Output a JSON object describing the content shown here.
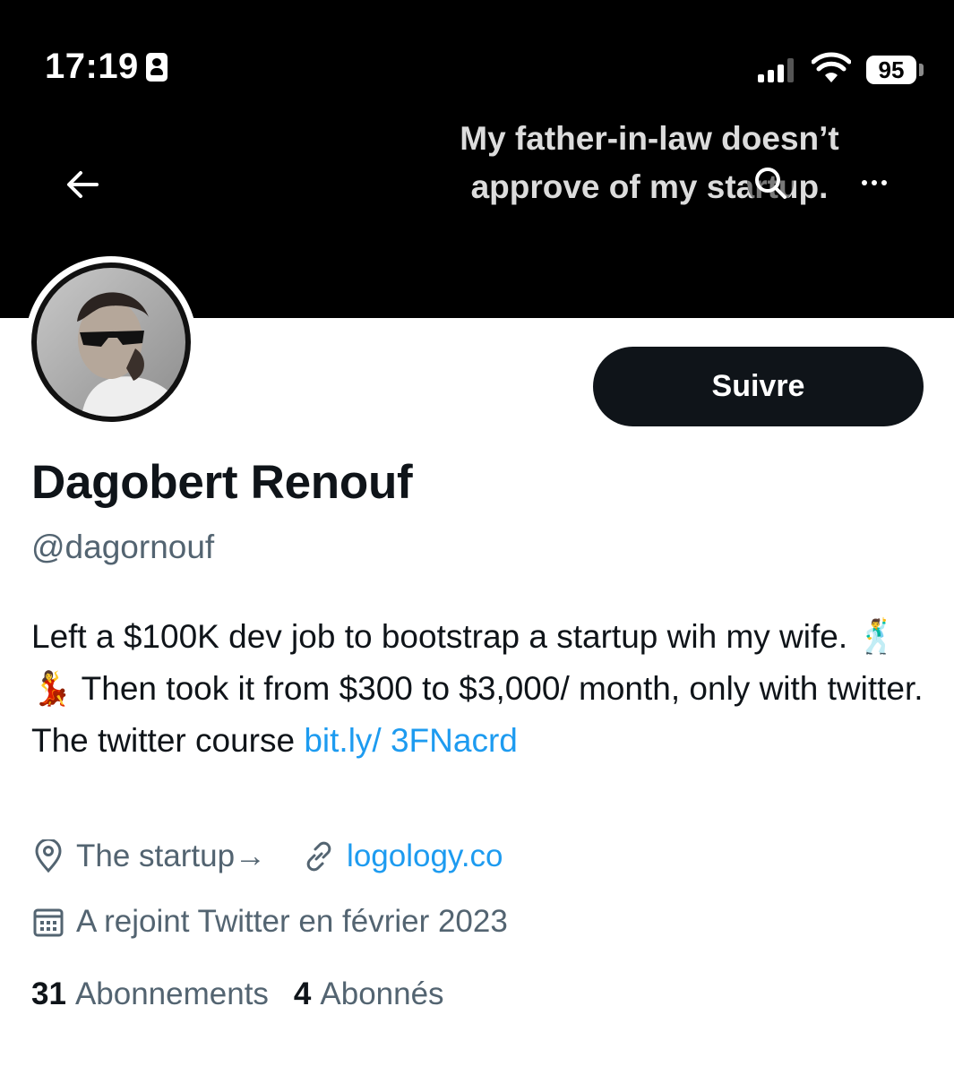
{
  "status_bar": {
    "time": "17:19",
    "battery": "95"
  },
  "banner": {
    "caption_line1": "My father-in-law doesn’t",
    "caption_line2": "approve of my startup."
  },
  "profile": {
    "follow_label": "Suivre",
    "name": "Dagobert Renouf",
    "handle": "@dagornouf",
    "bio": {
      "part1": "Left a $100K dev job to bootstrap a startup wih my wife. 🕺💃 Then took it from $300 to $3,000/ month, only with twitter. The twitter course ",
      "link": "bit.ly/ 3FNacrd"
    },
    "location": "The startup→",
    "website": "logology.co",
    "joined": "A rejoint Twitter en février 2023",
    "following_count": "31",
    "following_label": "Abonnements",
    "followers_count": "4",
    "followers_label": "Abonnés"
  },
  "icons": [
    "back-arrow-icon",
    "search-icon",
    "more-icon",
    "location-pin-icon",
    "link-icon",
    "calendar-icon",
    "id-card-icon",
    "signal-icon",
    "wifi-icon"
  ],
  "colors": {
    "accent": "#1d9bf0",
    "text": "#0f1419",
    "secondary": "#536471",
    "banner": "#000000"
  }
}
